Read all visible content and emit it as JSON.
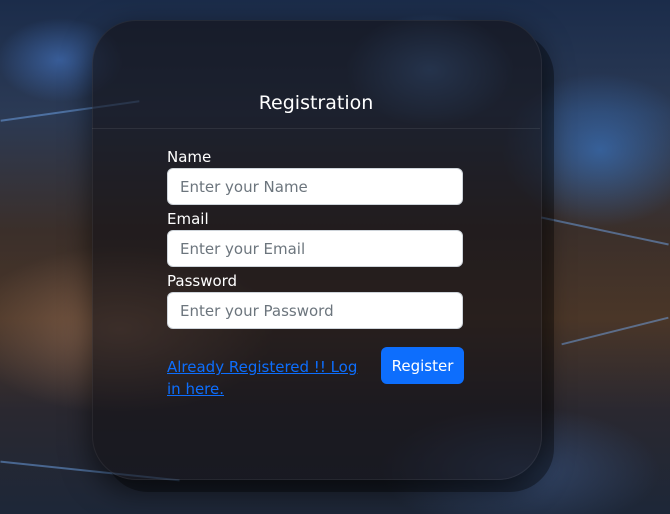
{
  "form": {
    "title": "Registration",
    "fields": [
      {
        "label": "Name",
        "placeholder": "Enter your Name",
        "value": ""
      },
      {
        "label": "Email",
        "placeholder": "Enter your Email",
        "value": ""
      },
      {
        "label": "Password",
        "placeholder": "Enter your Password",
        "value": ""
      }
    ],
    "login_link": "Already Registered !! Log in here.",
    "register_label": "Register"
  },
  "colors": {
    "accent": "#0d6efd",
    "link": "#0d6efd",
    "card_bg": "rgba(20,18,22,0.62)",
    "text": "#ffffff"
  }
}
